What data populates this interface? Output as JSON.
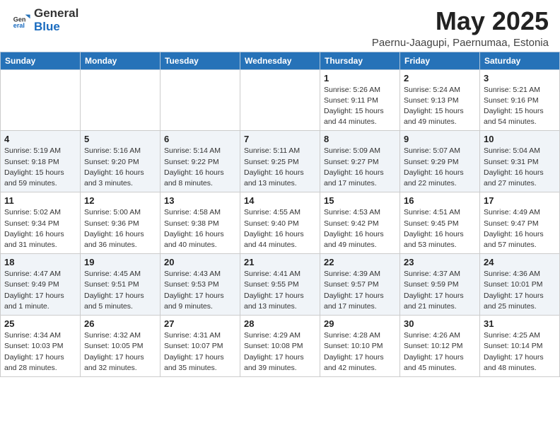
{
  "header": {
    "logo_general": "General",
    "logo_blue": "Blue",
    "title": "May 2025",
    "subtitle": "Paernu-Jaagupi, Paernumaa, Estonia"
  },
  "weekdays": [
    "Sunday",
    "Monday",
    "Tuesday",
    "Wednesday",
    "Thursday",
    "Friday",
    "Saturday"
  ],
  "weeks": [
    [
      {
        "day": "",
        "info": ""
      },
      {
        "day": "",
        "info": ""
      },
      {
        "day": "",
        "info": ""
      },
      {
        "day": "",
        "info": ""
      },
      {
        "day": "1",
        "info": "Sunrise: 5:26 AM\nSunset: 9:11 PM\nDaylight: 15 hours\nand 44 minutes."
      },
      {
        "day": "2",
        "info": "Sunrise: 5:24 AM\nSunset: 9:13 PM\nDaylight: 15 hours\nand 49 minutes."
      },
      {
        "day": "3",
        "info": "Sunrise: 5:21 AM\nSunset: 9:16 PM\nDaylight: 15 hours\nand 54 minutes."
      }
    ],
    [
      {
        "day": "4",
        "info": "Sunrise: 5:19 AM\nSunset: 9:18 PM\nDaylight: 15 hours\nand 59 minutes."
      },
      {
        "day": "5",
        "info": "Sunrise: 5:16 AM\nSunset: 9:20 PM\nDaylight: 16 hours\nand 3 minutes."
      },
      {
        "day": "6",
        "info": "Sunrise: 5:14 AM\nSunset: 9:22 PM\nDaylight: 16 hours\nand 8 minutes."
      },
      {
        "day": "7",
        "info": "Sunrise: 5:11 AM\nSunset: 9:25 PM\nDaylight: 16 hours\nand 13 minutes."
      },
      {
        "day": "8",
        "info": "Sunrise: 5:09 AM\nSunset: 9:27 PM\nDaylight: 16 hours\nand 17 minutes."
      },
      {
        "day": "9",
        "info": "Sunrise: 5:07 AM\nSunset: 9:29 PM\nDaylight: 16 hours\nand 22 minutes."
      },
      {
        "day": "10",
        "info": "Sunrise: 5:04 AM\nSunset: 9:31 PM\nDaylight: 16 hours\nand 27 minutes."
      }
    ],
    [
      {
        "day": "11",
        "info": "Sunrise: 5:02 AM\nSunset: 9:34 PM\nDaylight: 16 hours\nand 31 minutes."
      },
      {
        "day": "12",
        "info": "Sunrise: 5:00 AM\nSunset: 9:36 PM\nDaylight: 16 hours\nand 36 minutes."
      },
      {
        "day": "13",
        "info": "Sunrise: 4:58 AM\nSunset: 9:38 PM\nDaylight: 16 hours\nand 40 minutes."
      },
      {
        "day": "14",
        "info": "Sunrise: 4:55 AM\nSunset: 9:40 PM\nDaylight: 16 hours\nand 44 minutes."
      },
      {
        "day": "15",
        "info": "Sunrise: 4:53 AM\nSunset: 9:42 PM\nDaylight: 16 hours\nand 49 minutes."
      },
      {
        "day": "16",
        "info": "Sunrise: 4:51 AM\nSunset: 9:45 PM\nDaylight: 16 hours\nand 53 minutes."
      },
      {
        "day": "17",
        "info": "Sunrise: 4:49 AM\nSunset: 9:47 PM\nDaylight: 16 hours\nand 57 minutes."
      }
    ],
    [
      {
        "day": "18",
        "info": "Sunrise: 4:47 AM\nSunset: 9:49 PM\nDaylight: 17 hours\nand 1 minute."
      },
      {
        "day": "19",
        "info": "Sunrise: 4:45 AM\nSunset: 9:51 PM\nDaylight: 17 hours\nand 5 minutes."
      },
      {
        "day": "20",
        "info": "Sunrise: 4:43 AM\nSunset: 9:53 PM\nDaylight: 17 hours\nand 9 minutes."
      },
      {
        "day": "21",
        "info": "Sunrise: 4:41 AM\nSunset: 9:55 PM\nDaylight: 17 hours\nand 13 minutes."
      },
      {
        "day": "22",
        "info": "Sunrise: 4:39 AM\nSunset: 9:57 PM\nDaylight: 17 hours\nand 17 minutes."
      },
      {
        "day": "23",
        "info": "Sunrise: 4:37 AM\nSunset: 9:59 PM\nDaylight: 17 hours\nand 21 minutes."
      },
      {
        "day": "24",
        "info": "Sunrise: 4:36 AM\nSunset: 10:01 PM\nDaylight: 17 hours\nand 25 minutes."
      }
    ],
    [
      {
        "day": "25",
        "info": "Sunrise: 4:34 AM\nSunset: 10:03 PM\nDaylight: 17 hours\nand 28 minutes."
      },
      {
        "day": "26",
        "info": "Sunrise: 4:32 AM\nSunset: 10:05 PM\nDaylight: 17 hours\nand 32 minutes."
      },
      {
        "day": "27",
        "info": "Sunrise: 4:31 AM\nSunset: 10:07 PM\nDaylight: 17 hours\nand 35 minutes."
      },
      {
        "day": "28",
        "info": "Sunrise: 4:29 AM\nSunset: 10:08 PM\nDaylight: 17 hours\nand 39 minutes."
      },
      {
        "day": "29",
        "info": "Sunrise: 4:28 AM\nSunset: 10:10 PM\nDaylight: 17 hours\nand 42 minutes."
      },
      {
        "day": "30",
        "info": "Sunrise: 4:26 AM\nSunset: 10:12 PM\nDaylight: 17 hours\nand 45 minutes."
      },
      {
        "day": "31",
        "info": "Sunrise: 4:25 AM\nSunset: 10:14 PM\nDaylight: 17 hours\nand 48 minutes."
      }
    ]
  ]
}
